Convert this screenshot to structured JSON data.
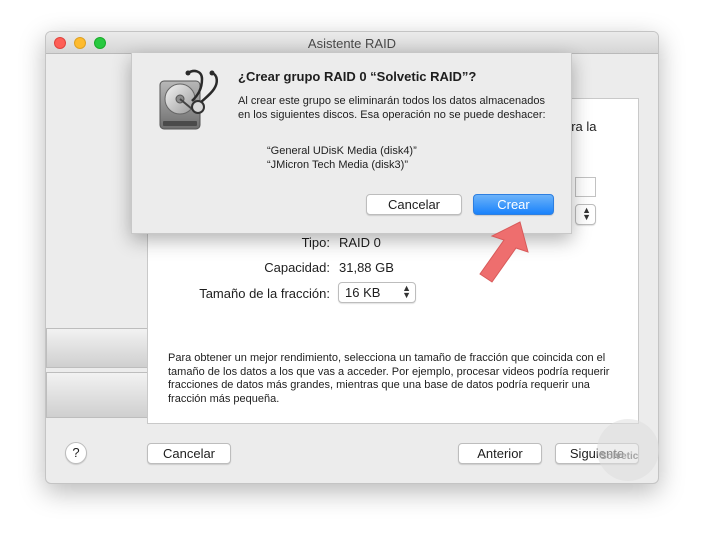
{
  "window": {
    "title": "Asistente RAID"
  },
  "partial_label": "ara la",
  "form": {
    "type_label": "Tipo:",
    "type_value": "RAID 0",
    "capacity_label": "Capacidad:",
    "capacity_value": "31,88 GB",
    "chunk_label": "Tamaño de la fracción:",
    "chunk_value": "16 KB"
  },
  "info_text": "Para obtener un mejor rendimiento, selecciona un tamaño de fracción que coincida con el tamaño de los datos a los que vas a acceder. Por ejemplo, procesar videos podría requerir fracciones de datos más grandes, mientras que una base de datos podría requerir una fracción más pequeña.",
  "bottom_bar": {
    "help_label": "?",
    "cancel_label": "Cancelar",
    "back_label": "Anterior",
    "next_label": "Siguiente"
  },
  "sheet": {
    "title": "¿Crear grupo RAID 0 “Solvetic RAID”?",
    "message": "Al crear este grupo se eliminarán todos los datos almacenados en los siguientes discos. Esa operación no se puede deshacer:",
    "disks": [
      "“General UDisK Media (disk4)”",
      "“JMicron Tech Media (disk3)”"
    ],
    "cancel_label": "Cancelar",
    "create_label": "Crear"
  },
  "icons": {
    "dialog_icon": "disk-utility-icon",
    "arrow": "annotation-arrow"
  },
  "colors": {
    "primary_button": "#1a82fb",
    "arrow": "#ee6e6e"
  },
  "watermark": {
    "text": "Solvetic"
  }
}
